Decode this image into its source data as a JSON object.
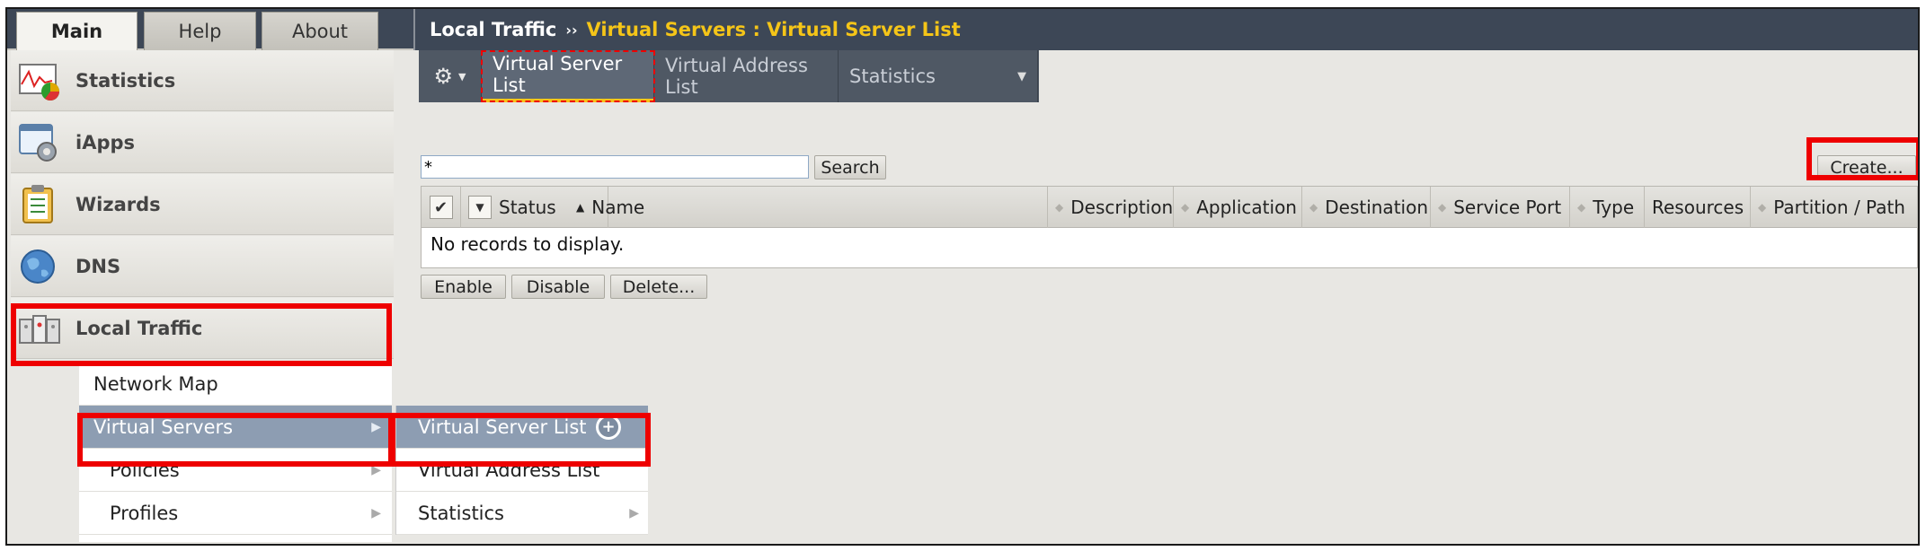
{
  "top_tabs": [
    {
      "label": "Main",
      "active": true
    },
    {
      "label": "Help",
      "active": false
    },
    {
      "label": "About",
      "active": false
    }
  ],
  "sidebar": {
    "items": [
      {
        "label": "Statistics",
        "icon": "statistics-chart-icon"
      },
      {
        "label": "iApps",
        "icon": "iapps-gear-icon"
      },
      {
        "label": "Wizards",
        "icon": "wizards-clipboard-icon"
      },
      {
        "label": "DNS",
        "icon": "dns-globe-icon"
      },
      {
        "label": "Local Traffic",
        "icon": "local-traffic-servers-icon"
      }
    ],
    "submenu": [
      {
        "label": "Network Map",
        "selected": false,
        "has_arrow": false
      },
      {
        "label": "Virtual Servers",
        "selected": true,
        "has_arrow": true
      },
      {
        "label": "Policies",
        "selected": false,
        "has_arrow": true
      },
      {
        "label": "Profiles",
        "selected": false,
        "has_arrow": true
      }
    ],
    "flyout": [
      {
        "label": "Virtual Server List",
        "selected": true,
        "icon": "add-circle-icon"
      },
      {
        "label": "Virtual Address List",
        "selected": false
      },
      {
        "label": "Statistics",
        "selected": false,
        "has_arrow": true
      }
    ]
  },
  "breadcrumb": {
    "root": "Local Traffic",
    "separator": "››",
    "current": "Virtual Servers : Virtual Server List"
  },
  "subnav": {
    "gear_icon": "gear-icon",
    "tabs": [
      {
        "label": "Virtual Server List",
        "active": true
      },
      {
        "label": "Virtual Address List",
        "active": false
      },
      {
        "label": "Statistics",
        "active": false,
        "dropdown": true
      }
    ]
  },
  "search": {
    "value": "*",
    "button_label": "Search"
  },
  "create_button_label": "Create...",
  "table": {
    "columns": [
      "Status",
      "Name",
      "Description",
      "Application",
      "Destination",
      "Service Port",
      "Type",
      "Resources",
      "Partition / Path"
    ],
    "empty_message": "No records to display."
  },
  "actions": {
    "enable": "Enable",
    "disable": "Disable",
    "delete": "Delete..."
  },
  "colors": {
    "header_bg": "#3d4756",
    "highlight": "#ee0000",
    "breadcrumb_accent": "#f5c518",
    "selected_row": "#8d9db2"
  }
}
